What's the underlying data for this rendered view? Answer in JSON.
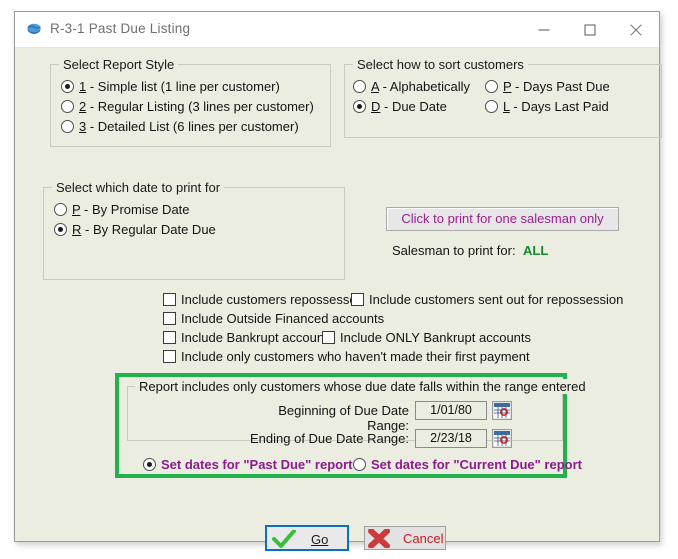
{
  "window": {
    "title": "R-3-1  Past Due Listing",
    "icon": "globe-icon",
    "controls": {
      "minimize": "–",
      "maximize": "□",
      "close": "✕"
    }
  },
  "report_style": {
    "legend": "Select Report Style",
    "options": [
      {
        "key": "1",
        "label": " - Simple list (1 line per customer)",
        "selected": true
      },
      {
        "key": "2",
        "label": " - Regular Listing (3 lines per customer)",
        "selected": false
      },
      {
        "key": "3",
        "label": " - Detailed List (6 lines per customer)",
        "selected": false
      }
    ]
  },
  "sort_customers": {
    "legend": "Select how to sort customers",
    "options": [
      {
        "key": "A",
        "label": " - Alphabetically",
        "selected": false
      },
      {
        "key": "D",
        "label": " - Due Date",
        "selected": true
      },
      {
        "key": "P",
        "label": " - Days Past Due",
        "selected": false
      },
      {
        "key": "L",
        "label": " - Days Last Paid",
        "selected": false
      }
    ]
  },
  "date_to_print": {
    "legend": "Select which date to print for",
    "options": [
      {
        "key": "P",
        "label": " - By Promise Date",
        "selected": false
      },
      {
        "key": "R",
        "label": " - By Regular Date Due",
        "selected": true
      }
    ]
  },
  "salesman": {
    "button_label": "Click to print for one salesman only",
    "label": "Salesman to print for:",
    "value": "ALL",
    "button_color": "#9b1f8c",
    "value_color": "#128a2e"
  },
  "include_options": [
    {
      "label": "Include customers repossessed",
      "checked": false
    },
    {
      "label": "Include customers sent out for repossession",
      "checked": false
    },
    {
      "label": "Include Outside Financed accounts",
      "checked": false
    },
    {
      "label": "Include Bankrupt accounts",
      "checked": false
    },
    {
      "label": "Include ONLY Bankrupt accounts",
      "checked": false
    },
    {
      "label": "Include only customers who haven't made their first payment",
      "checked": false
    }
  ],
  "date_range": {
    "highlight_color": "#22b14c",
    "legend": "Report includes only customers whose due date falls within the range entered",
    "beginning_label": "Beginning of Due Date Range:",
    "beginning_value": "1/01/80",
    "ending_label": "Ending of Due Date Range:",
    "ending_value": "2/23/18",
    "calendar_icon": "calendar-icon",
    "mode_options": [
      {
        "label": "Set dates for \"Past Due\" report",
        "selected": true
      },
      {
        "label": "Set dates for \"Current Due\" report",
        "selected": false
      }
    ],
    "mode_color": "#8e1a8e"
  },
  "actions": {
    "go_label": "Go",
    "go_icon": "check-icon",
    "cancel_label": "Cancel",
    "cancel_icon": "x-icon"
  }
}
